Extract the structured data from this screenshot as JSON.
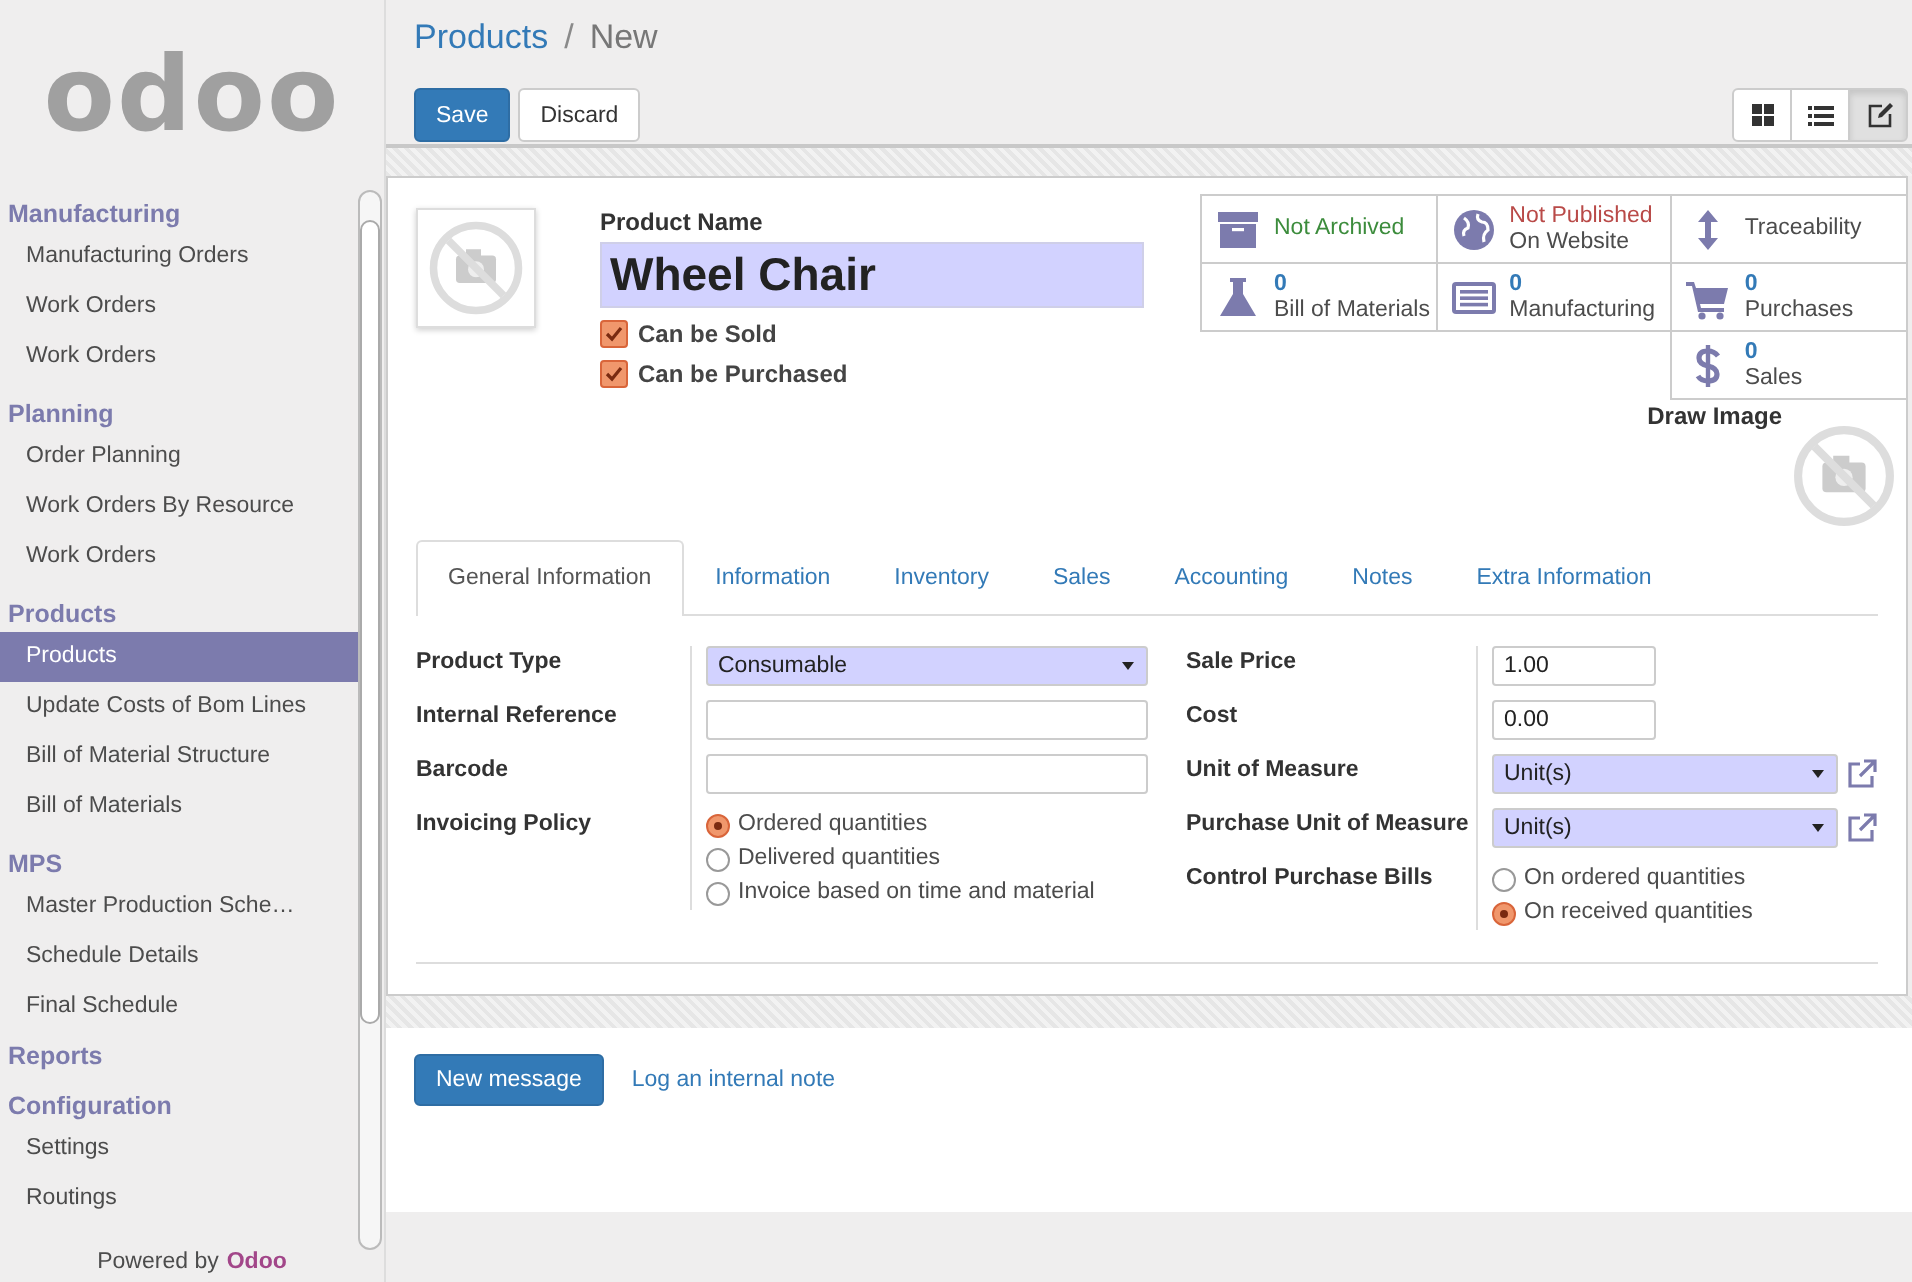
{
  "logo": {
    "text": "odoo"
  },
  "sidebar": {
    "sections": [
      {
        "title": "Manufacturing",
        "items": [
          {
            "label": "Manufacturing Orders",
            "selected": false
          },
          {
            "label": "Work Orders",
            "selected": false
          },
          {
            "label": "Work Orders",
            "selected": false
          }
        ]
      },
      {
        "title": "Planning",
        "items": [
          {
            "label": "Order Planning",
            "selected": false
          },
          {
            "label": "Work Orders By Resource",
            "selected": false
          },
          {
            "label": "Work Orders",
            "selected": false
          }
        ]
      },
      {
        "title": "Products",
        "items": [
          {
            "label": "Products",
            "selected": true
          },
          {
            "label": "Update Costs of Bom Lines",
            "selected": false
          },
          {
            "label": "Bill of Material Structure",
            "selected": false
          },
          {
            "label": "Bill of Materials",
            "selected": false
          }
        ]
      },
      {
        "title": "MPS",
        "items": [
          {
            "label": "Master Production Sche…",
            "selected": false
          },
          {
            "label": "Schedule Details",
            "selected": false
          },
          {
            "label": "Final Schedule",
            "selected": false
          }
        ]
      },
      {
        "title": "Reports"
      },
      {
        "title": "Configuration",
        "items": [
          {
            "label": "Settings",
            "selected": false
          },
          {
            "label": "Routings",
            "selected": false
          }
        ]
      }
    ],
    "footer": {
      "prefix": "Powered by",
      "brand": "Odoo"
    }
  },
  "breadcrumb": {
    "parent": "Products",
    "separator": "/",
    "current": "New"
  },
  "buttons": [
    {
      "label": "Save",
      "kind": "primary"
    },
    {
      "label": "Discard",
      "kind": "default"
    }
  ],
  "view_switcher": [
    {
      "kind": "kanban",
      "selected": false
    },
    {
      "kind": "list",
      "selected": false
    },
    {
      "kind": "form",
      "selected": true
    }
  ],
  "product": {
    "name_label": "Product Name",
    "name": "Wheel Chair",
    "options": [
      {
        "label": "Can be Sold",
        "checked": true
      },
      {
        "label": "Can be Purchased",
        "checked": true
      }
    ]
  },
  "smart_buttons": [
    {
      "kind": "status",
      "text": "Not Archived",
      "positive": true
    },
    {
      "kind": "status",
      "text": "Not Published",
      "subtext": "On Website",
      "positive": false
    },
    {
      "kind": "action",
      "text": "Traceability"
    },
    {
      "kind": "count",
      "count": "0",
      "text": "Bill of Materials"
    },
    {
      "kind": "count",
      "count": "0",
      "text": "Manufacturing"
    },
    {
      "kind": "count",
      "count": "0",
      "text": "Purchases"
    },
    {
      "kind": "count",
      "count": "0",
      "text": "Sales"
    }
  ],
  "draw_image": {
    "label": "Draw Image"
  },
  "tabs": [
    {
      "label": "General Information",
      "selected": true
    },
    {
      "label": "Information",
      "selected": false
    },
    {
      "label": "Inventory",
      "selected": false
    },
    {
      "label": "Sales",
      "selected": false
    },
    {
      "label": "Accounting",
      "selected": false
    },
    {
      "label": "Notes",
      "selected": false
    },
    {
      "label": "Extra Information",
      "selected": false
    }
  ],
  "left_fields": [
    {
      "label": "Product Type",
      "kind": "select",
      "value": "Consumable",
      "required": true,
      "external_link": false
    },
    {
      "label": "Internal Reference",
      "kind": "input",
      "required": false
    },
    {
      "label": "Barcode",
      "kind": "input",
      "required": false
    },
    {
      "label": "Invoicing Policy",
      "kind": "radio",
      "options": [
        {
          "label": "Ordered quantities",
          "selected": true
        },
        {
          "label": "Delivered quantities",
          "selected": false
        },
        {
          "label": "Invoice based on time and material",
          "selected": false
        }
      ]
    }
  ],
  "right_fields": [
    {
      "label": "Sale Price",
      "kind": "input",
      "value": "1.00",
      "required": false
    },
    {
      "label": "Cost",
      "kind": "input",
      "value": "0.00",
      "required": false
    },
    {
      "label": "Unit of Measure",
      "kind": "select",
      "value": "Unit(s)",
      "required": true,
      "external_link": true
    },
    {
      "label": "Purchase Unit of Measure",
      "kind": "select",
      "value": "Unit(s)",
      "required": true,
      "external_link": true
    },
    {
      "label": "Control Purchase Bills",
      "kind": "radio",
      "options": [
        {
          "label": "On ordered quantities",
          "selected": false
        },
        {
          "label": "On received quantities",
          "selected": true
        }
      ]
    }
  ],
  "chatter": [
    {
      "label": "New message",
      "kind": "primary"
    },
    {
      "label": "Log an internal note",
      "kind": "link"
    }
  ]
}
